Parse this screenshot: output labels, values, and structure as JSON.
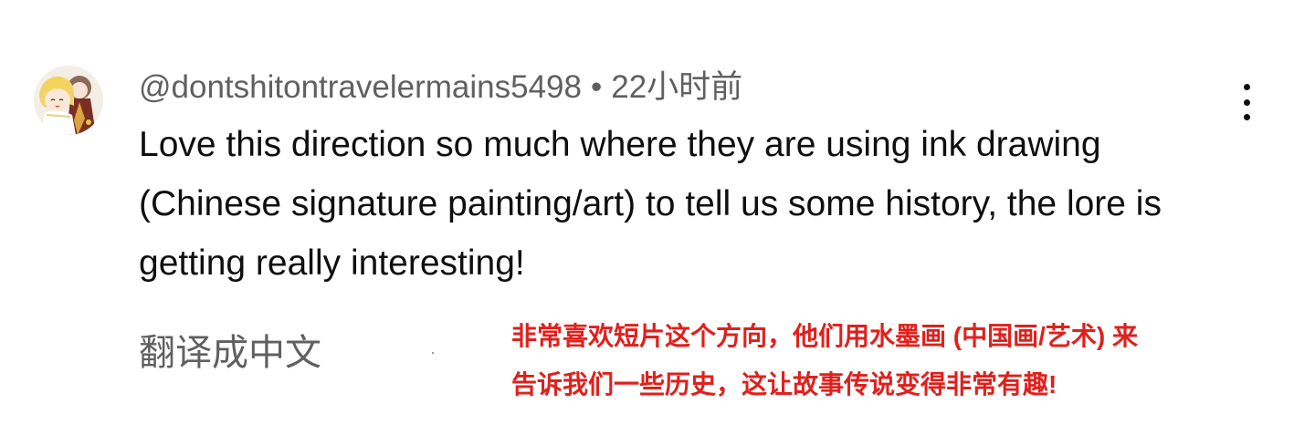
{
  "comment": {
    "author": "@dontshitontravelermains5498",
    "separator": "•",
    "time": "22小时前",
    "text": "Love this direction so much where they are using ink drawing (Chinese signature painting/art) to tell us some history, the lore is getting really interesting!",
    "translate_label": "翻译成中文",
    "avatar_icon": "anime-avatar-icon",
    "more_icon": "more-vert-icon"
  },
  "overlay_translation": {
    "line1": "非常喜欢短片这个方向，他们用水墨画 (中国画/艺术) 来",
    "line2": "告诉我们一些历史，这让故事传说变得非常有趣!",
    "color": "#e0201c"
  }
}
